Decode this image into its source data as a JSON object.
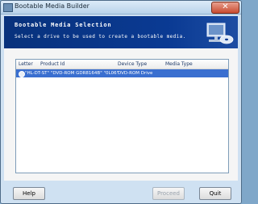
{
  "window": {
    "title": "Bootable Media Builder",
    "close_symbol": "✕"
  },
  "header": {
    "title": "Bootable Media Selection",
    "subtitle": "Select a drive to be used to create a bootable media."
  },
  "table": {
    "columns": [
      "Letter",
      "Product Id",
      "Device Type",
      "Media Type"
    ],
    "rows": [
      {
        "letter": "",
        "product_id": "\"HL-DT-ST\" \"DVD-ROM GDR8164B\" \"0L06\"",
        "device_type": "DVD-ROM Drive",
        "media_type": "",
        "selected": true
      }
    ]
  },
  "buttons": {
    "help": "Help",
    "proceed": "Proceed",
    "quit": "Quit"
  },
  "colors": {
    "header_bg": "#08327c",
    "selection": "#3a6fd0"
  },
  "icons": {
    "app": "app-icon",
    "header": "computer-disc-icon",
    "row": "disc-drive-icon"
  }
}
